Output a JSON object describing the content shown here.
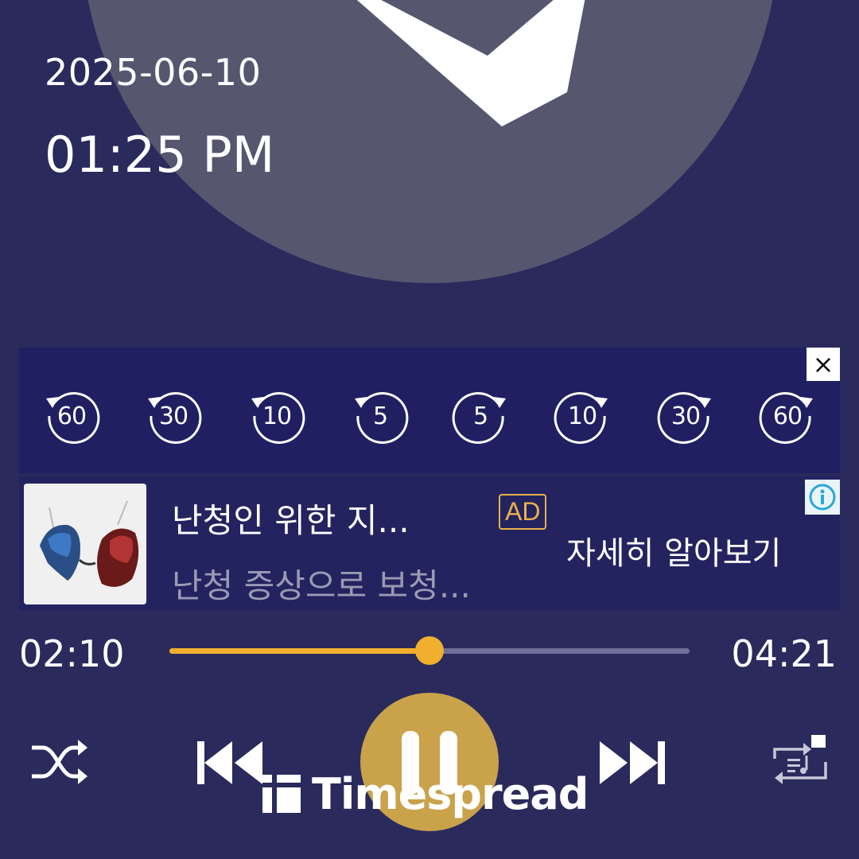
{
  "header": {
    "date": "2025-06-10",
    "time": "01:25 PM"
  },
  "seek_buttons": [
    {
      "label": "60",
      "direction": "back"
    },
    {
      "label": "30",
      "direction": "back"
    },
    {
      "label": "10",
      "direction": "back"
    },
    {
      "label": "5",
      "direction": "back"
    },
    {
      "label": "5",
      "direction": "forward"
    },
    {
      "label": "10",
      "direction": "forward"
    },
    {
      "label": "30",
      "direction": "forward"
    },
    {
      "label": "60",
      "direction": "forward"
    }
  ],
  "seek_panel": {
    "close_label": "×"
  },
  "ad": {
    "title": "난청인 위한 지...",
    "subtitle": "난청 증상으로 보청...",
    "badge": "AD",
    "cta": "자세히 알아보기",
    "info_icon": "info-icon"
  },
  "player": {
    "current_time": "02:10",
    "total_time": "04:21",
    "progress": 0.5
  },
  "controls": {
    "shuffle_icon": "shuffle-icon",
    "previous_icon": "previous-icon",
    "pause_icon": "pause-icon",
    "next_icon": "next-icon",
    "playlist_repeat_icon": "playlist-repeat-icon"
  },
  "watermark": {
    "text": "Timespread"
  },
  "colors": {
    "background": "#2a2a5c",
    "accent": "#f0b02d",
    "play_button": "#c9a24a",
    "ad_badge": "#e8b14a"
  }
}
